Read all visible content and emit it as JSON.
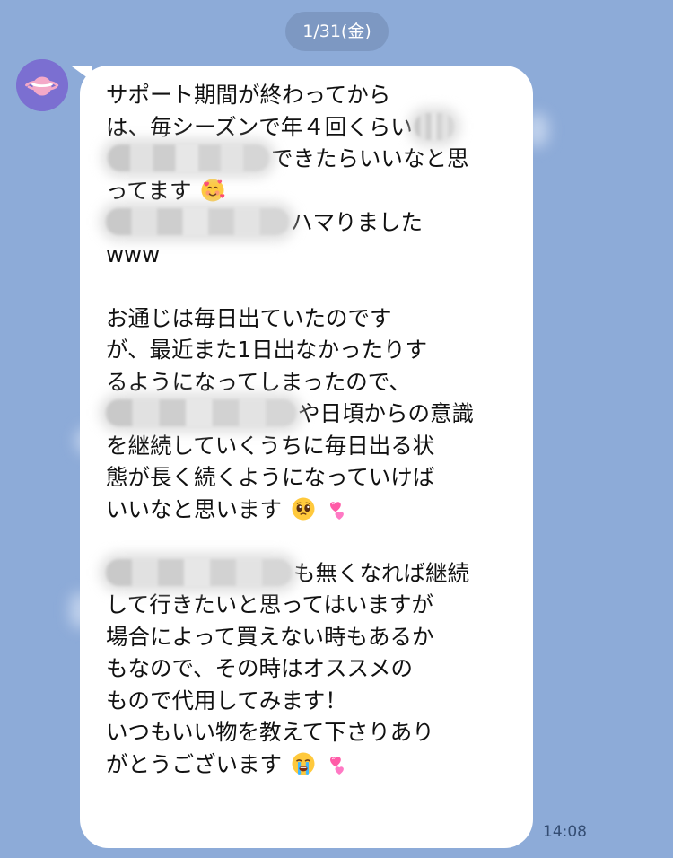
{
  "chat": {
    "date_label": "1/31(金)",
    "message": {
      "lines": [
        "サポート期間が終わってから",
        "は、毎シーズンで年４回くらい",
        "できたらいいなと思",
        "ってます",
        "ハマりました",
        "www",
        "お通じは毎日出ていたのです",
        "が、最近また1日出なかったりす",
        "るようになってしまったので、",
        "や日頃からの意識",
        "を継続していくうちに毎日出る状",
        "態が長く続くようになっていけば",
        "いいなと思います",
        "も無くなれば継続",
        "して行きたいと思ってはいますが",
        "場合によって買えない時もあるか",
        "もなので、その時はオススメの",
        "もので代用してみます！",
        "いつもいい物を教えて下さりあり",
        "がとうございます"
      ],
      "time": "14:08"
    }
  },
  "icons": {
    "avatar": "planet-icon",
    "emoji_1": "smiling-face-with-hearts-emoji",
    "emoji_2": "pleading-face-emoji",
    "emoji_3": "two-hearts-emoji",
    "emoji_4": "loudly-crying-face-emoji"
  },
  "colors": {
    "background": "#8dabd8",
    "bubble": "#ffffff",
    "avatar_bg": "#7b6fd1",
    "timestamp": "#344d73"
  }
}
